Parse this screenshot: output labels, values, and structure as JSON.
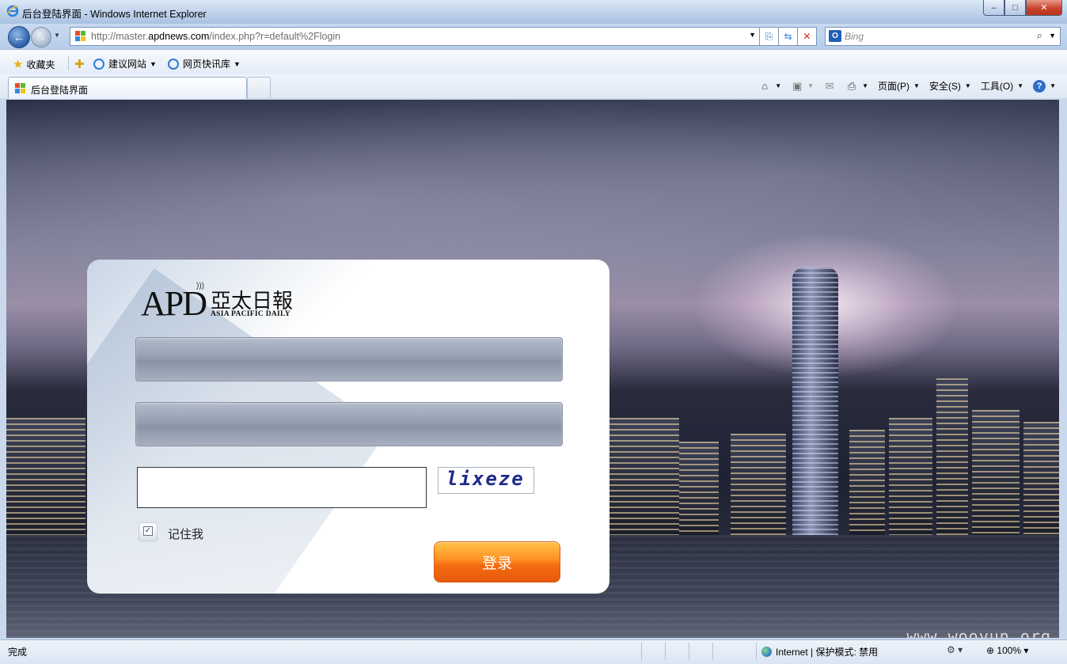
{
  "window": {
    "title": "后台登陆界面 - Windows Internet Explorer",
    "controls": {
      "minimize": "–",
      "maximize": "□",
      "close": "✕"
    }
  },
  "nav": {
    "url_prefix": "http://master.",
    "url_domain": "apdnews.com",
    "url_suffix": "/index.php?r=default%2Flogin",
    "search_placeholder": "Bing",
    "search_logo": "O"
  },
  "favorites": {
    "label": "收藏夹",
    "items": [
      {
        "label": "建议网站"
      },
      {
        "label": "网页快讯库"
      }
    ]
  },
  "tabs": {
    "active_label": "后台登陆界面"
  },
  "command_bar": {
    "page": "页面(P)",
    "safety": "安全(S)",
    "tools": "工具(O)"
  },
  "login": {
    "logo_apd": "APD",
    "logo_cn": "亞太日報",
    "logo_en": "ASIA PACIFIC DAILY",
    "username_value": "",
    "password_value": "",
    "captcha_value": "",
    "captcha_text": "lixeze",
    "remember_label": "记住我",
    "remember_checked": true,
    "submit_label": "登录"
  },
  "content": {
    "watermark": "www.wooyun.org"
  },
  "status": {
    "text": "完成",
    "zone": "Internet | 保护模式: 禁用",
    "zoom": "100%"
  },
  "colors": {
    "login_button": "#f36b10",
    "field_fill": "#969fb1",
    "captcha_text": "#1e2a8a",
    "titlebar": "#bcd0ea"
  }
}
